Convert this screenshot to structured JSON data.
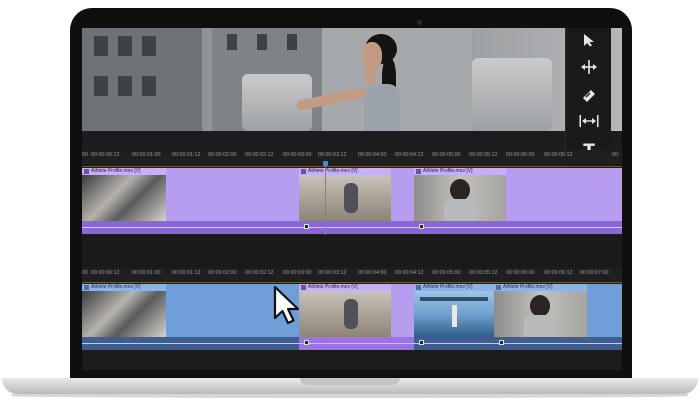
{
  "app": {
    "accent_clip_purple": "#b79df0",
    "accent_clip_blue": "#6f9ed8",
    "playhead_color": "#3a8ef6"
  },
  "tools": [
    {
      "name": "selection-tool",
      "icon": "arrow-pointer-icon"
    },
    {
      "name": "ripple-edit-tool",
      "icon": "ripple-edit-icon"
    },
    {
      "name": "razor-tool",
      "icon": "razor-icon"
    },
    {
      "name": "slip-tool",
      "icon": "slip-icon"
    },
    {
      "name": "type-tool",
      "icon": "type-icon",
      "glyph": "T"
    }
  ],
  "timeline_top": {
    "ruler_labels": [
      "00",
      "00:00:00:12",
      "00:00:01:00",
      "00:00:01:12",
      "00:00:02:00",
      "00:00:02:12",
      "00:00:03:00",
      "00:00:03:12",
      "00:00:04:00",
      "00:00:04:12",
      "00:00:05:00",
      "00:00:05:12",
      "00:00:06:00",
      "00:00:06:12",
      "00:"
    ],
    "clips": [
      {
        "label": "Athlete Profile.mov [V]",
        "style": "purple"
      },
      {
        "label": "Athlete Profile.mov [V]",
        "style": "purple"
      },
      {
        "label": "Athlete Profile.mov [V]",
        "style": "purple"
      }
    ]
  },
  "timeline_bottom": {
    "ruler_labels": [
      "00",
      "00:00:00:12",
      "00:00:01:00",
      "00:00:01:12",
      "00:00:02:00",
      "00:00:02:12",
      "00:00:03:00",
      "00:00:03:12",
      "00:00:04:00",
      "00:00:04:12",
      "00:00:05:00",
      "00:00:05:12",
      "00:00:06:00",
      "00:00:06:12",
      "00:00:07:00"
    ],
    "clips": [
      {
        "label": "Athlete Profile.mov [V]",
        "style": "blue"
      },
      {
        "label": "Athlete Profile.mov [V]",
        "style": "purple"
      },
      {
        "label": "Athlete Profile.mov [V]",
        "style": "blue"
      },
      {
        "label": "Athlete Profile.mov [V]",
        "style": "blue"
      }
    ]
  }
}
